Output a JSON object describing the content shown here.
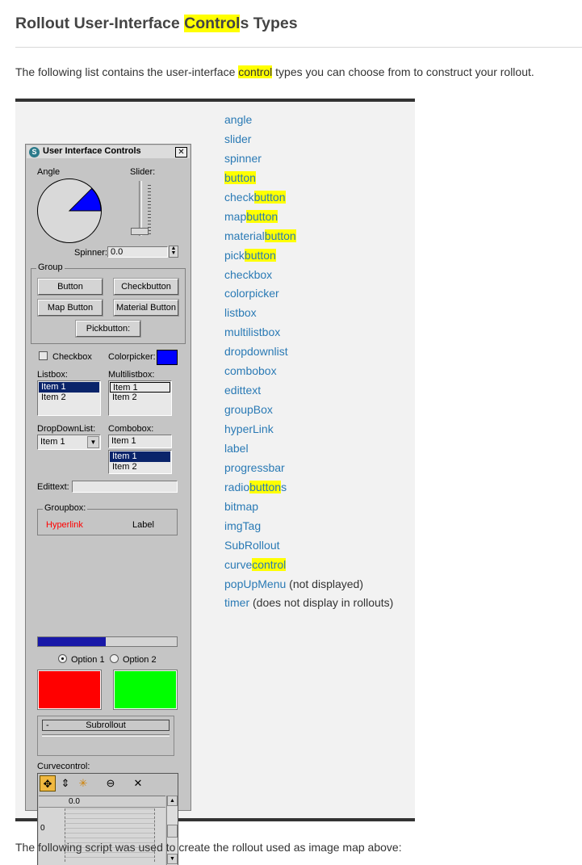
{
  "page": {
    "title_prefix": "Rollout User-Interface ",
    "title_highlight": "Control",
    "title_suffix": "s Types",
    "intro_prefix": "The following list contains the user-interface ",
    "intro_highlight": "control",
    "intro_suffix": " types you can choose from to construct your rollout.",
    "outro": "The following script was used to create the rollout used as image map above:"
  },
  "control_types": {
    "angle": "angle",
    "slider": "slider",
    "spinner": "spinner",
    "button": "button",
    "check_pre": "check",
    "check_hl": "button",
    "map_pre": "map",
    "map_hl": "button",
    "material_pre": "material",
    "material_hl": "button",
    "pick_pre": "pick",
    "pick_hl": "button",
    "checkbox": "checkbox",
    "colorpicker": "colorpicker",
    "listbox": "listbox",
    "multilistbox": "multilistbox",
    "dropdownlist": "dropdownlist",
    "combobox": "combobox",
    "edittext": "edittext",
    "groupbox": "groupBox",
    "hyperlink": "hyperLink",
    "label": "label",
    "progressbar": "progressbar",
    "radio_pre": "radio",
    "radio_hl": "button",
    "radio_suf": "s",
    "bitmap": "bitmap",
    "imgtag": "imgTag",
    "subrollout": "SubRollout",
    "curve_pre": "curve",
    "curve_hl": "control",
    "popupmenu": "popUpMenu",
    "popupmenu_note": " (not displayed)",
    "timer": "timer",
    "timer_note": " (does not display in rollouts)"
  },
  "dialog": {
    "title": "User Interface Controls",
    "logo": "S",
    "close": "✕",
    "angle_label": "Angle",
    "angle_degrees": 45,
    "slider_label": "Slider:",
    "spinner_label": "Spinner:",
    "spinner_value": "0.0",
    "group_caption": "Group",
    "button": "Button",
    "checkbutton": "Checkbutton",
    "map_button": "Map Button",
    "material_button": "Material Button",
    "pickbutton": "Pickbutton:",
    "checkbox_label": "Checkbox",
    "colorpicker_label": "Colorpicker:",
    "colorpicker_color": "#0000ff",
    "listbox_label": "Listbox:",
    "listbox_items": [
      "Item 1",
      "Item 2"
    ],
    "multilistbox_label": "Multilistbox:",
    "multilistbox_items": [
      "Item 1",
      "Item 2"
    ],
    "dropdown_label": "DropDownList:",
    "dropdown_value": "Item 1",
    "combobox_label": "Combobox:",
    "combobox_value": "Item 1",
    "combobox_items": [
      "Item 1",
      "Item 2"
    ],
    "edittext_label": "Edittext:",
    "groupbox_caption": "Groupbox:",
    "hyperlink": "Hyperlink",
    "hyperlink_color": "#ff0000",
    "label": "Label",
    "progress_fraction": 0.49,
    "option1": "Option 1",
    "option2": "Option 2",
    "bitmap1_color": "#ff0000",
    "bitmap2_color": "#00ff00",
    "subrollout_minus": "-",
    "subrollout": "Subrollout",
    "curvecontrol_label": "Curvecontrol:",
    "curve_ruler_value": "0.0",
    "curve_zero": "0"
  }
}
